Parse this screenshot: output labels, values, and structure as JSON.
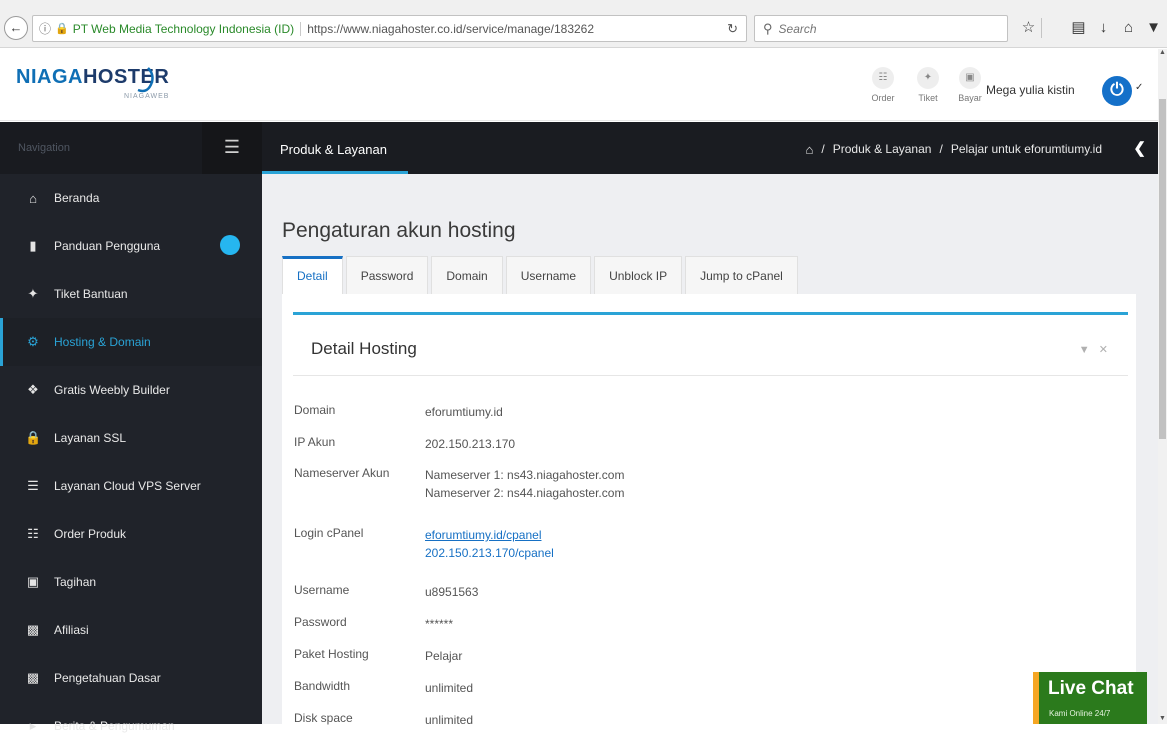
{
  "browser": {
    "site_identity": "PT Web Media Technology Indonesia (ID)",
    "url": "https://www.niagahoster.co.id/service/manage/183262",
    "search_placeholder": "Search"
  },
  "header": {
    "logo_niaga": "NIAGA",
    "logo_hoster": "HOSTER",
    "logo_sub": "NIAGAWEB",
    "order_label": "Order",
    "ticket_label": "Tiket",
    "pay_label": "Bayar",
    "user_name": "Mega yulia kistin"
  },
  "sidebar": {
    "title": "Navigation",
    "items": [
      {
        "label": "Beranda",
        "icon": "home-icon"
      },
      {
        "label": "Panduan Pengguna",
        "icon": "video-icon"
      },
      {
        "label": "Tiket Bantuan",
        "icon": "tag-icon"
      },
      {
        "label": "Hosting & Domain",
        "icon": "cogs-icon"
      },
      {
        "label": "Gratis Weebly Builder",
        "icon": "gift-icon"
      },
      {
        "label": "Layanan SSL",
        "icon": "lock-icon"
      },
      {
        "label": "Layanan Cloud VPS Server",
        "icon": "server-icon"
      },
      {
        "label": "Order Produk",
        "icon": "cart-icon"
      },
      {
        "label": "Tagihan",
        "icon": "money-icon"
      },
      {
        "label": "Afiliasi",
        "icon": "briefcase-icon"
      },
      {
        "label": "Pengetahuan Dasar",
        "icon": "book-icon"
      },
      {
        "label": "Berita & Pengumuman",
        "icon": "megaphone-icon"
      }
    ]
  },
  "section": {
    "title": "Produk & Layanan",
    "breadcrumb": [
      "Produk & Layanan",
      "Pelajar untuk eforumtiumy.id"
    ]
  },
  "main": {
    "page_title": "Pengaturan akun hosting",
    "tabs": [
      "Detail",
      "Password",
      "Domain",
      "Username",
      "Unblock IP",
      "Jump to cPanel"
    ],
    "card_title": "Detail Hosting",
    "details": {
      "domain_label": "Domain",
      "domain_value": "eforumtiumy.id",
      "ip_label": "IP Akun",
      "ip_value": "202.150.213.170",
      "ns_label": "Nameserver Akun",
      "ns1": "Nameserver 1: ns43.niagahoster.com",
      "ns2": "Nameserver 2: ns44.niagahoster.com",
      "login_label": "Login cPanel",
      "login1": "eforumtiumy.id/cpanel",
      "login2": "202.150.213.170/cpanel",
      "username_label": "Username",
      "username_value": "u8951563",
      "password_label": "Password",
      "password_value": "******",
      "package_label": "Paket Hosting",
      "package_value": "Pelajar",
      "bandwidth_label": "Bandwidth",
      "bandwidth_value": "unlimited",
      "disk_label": "Disk space",
      "disk_value": "unlimited"
    }
  },
  "livechat": {
    "title": "Live Chat",
    "subtitle": "Kami Online 24/7"
  }
}
